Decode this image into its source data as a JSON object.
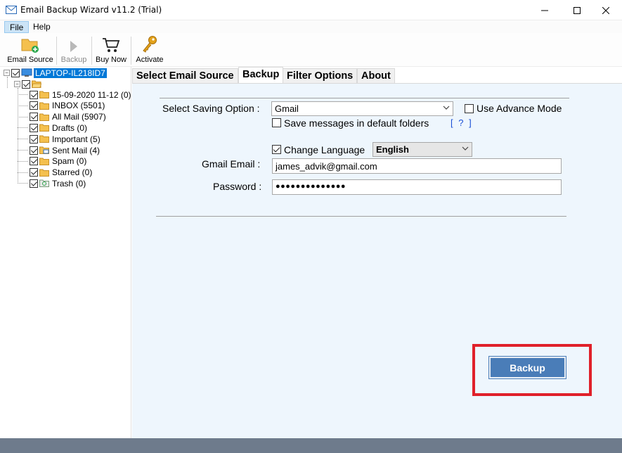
{
  "window": {
    "title": "Email Backup Wizard v11.2 (Trial)",
    "controls": [
      "minimize",
      "maximize",
      "close"
    ]
  },
  "menu": {
    "file": "File",
    "help": "Help"
  },
  "toolbar": {
    "email_source": "Email Source",
    "backup": "Backup",
    "buy_now": "Buy Now",
    "activate": "Activate"
  },
  "tree": {
    "root": "LAPTOP-IL218ID7",
    "folders": [
      "15-09-2020 11-12 (0)",
      "INBOX (5501)",
      "All Mail (5907)",
      "Drafts (0)",
      "Important (5)",
      "Sent Mail (4)",
      "Spam (0)",
      "Starred (0)",
      "Trash (0)"
    ]
  },
  "tabs": [
    "Select Email Source",
    "Backup",
    "Filter Options",
    "About"
  ],
  "active_tab": "Backup",
  "form": {
    "saving_option_label": "Select Saving Option :",
    "saving_option_value": "Gmail",
    "advance_mode_label": "Use Advance Mode",
    "advance_mode_checked": false,
    "default_folders_label": "Save messages in default folders",
    "default_folders_checked": false,
    "help_link": "[ ? ]",
    "change_language_label": "Change Language",
    "change_language_checked": true,
    "language_value": "English",
    "email_label": "Gmail Email :",
    "email_value": "james_advik@gmail.com",
    "password_label": "Password :",
    "password_value": "●●●●●●●●●●●●●●"
  },
  "backup_button": "Backup",
  "colors": {
    "accent": "#0078d7",
    "button": "#4a7db8",
    "highlight": "#e0202a",
    "panel_bg": "#eef6fd",
    "status_bar": "#6e7b8c"
  }
}
